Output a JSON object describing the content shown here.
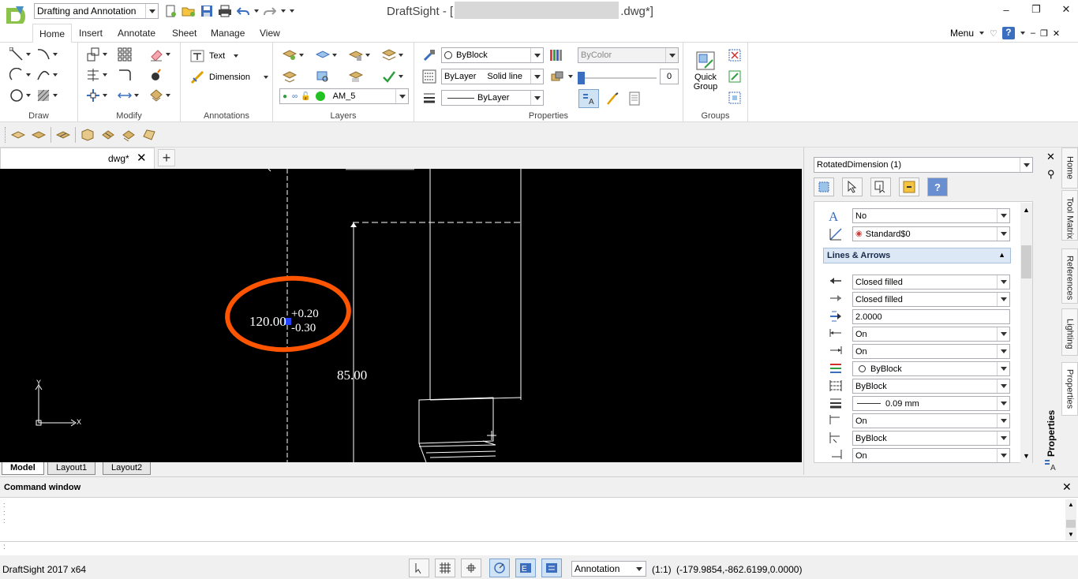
{
  "title_bar": {
    "workspace": "Drafting and Annotation",
    "app_title_prefix": "DraftSight - [",
    "app_title_suffix": ".dwg*]"
  },
  "ribbon_tabs": [
    "Home",
    "Insert",
    "Annotate",
    "Sheet",
    "Manage",
    "View"
  ],
  "ribbon_right": {
    "menu_label": "Menu"
  },
  "groups": {
    "draw": "Draw",
    "modify": "Modify",
    "annotations": "Annotations",
    "layers": "Layers",
    "properties": "Properties",
    "groups": "Groups"
  },
  "annotations": {
    "text_label": "Text",
    "dimension_label": "Dimension"
  },
  "layers": {
    "current_layer": "AM_5"
  },
  "properties": {
    "color": "ByBlock",
    "linestyle_layer": "ByLayer",
    "linestyle_style": "Solid line",
    "lineweight": "ByLayer",
    "transparency_color": "ByColor",
    "transparency_value": "0"
  },
  "groups_panel": {
    "quick_group_line1": "Quick",
    "quick_group_line2": "Group"
  },
  "document": {
    "tab_name": "dwg*"
  },
  "canvas": {
    "dimension_main": "120.00",
    "tolerance_upper": "+0.20",
    "tolerance_lower": "-0.30",
    "dimension_85": "85.00",
    "axis_x": "X",
    "axis_y": "Y"
  },
  "layout_tabs": [
    "Model",
    "Layout1",
    "Layout2"
  ],
  "props_panel": {
    "selection": "RotatedDimension (1)",
    "section_title": "Lines & Arrows",
    "rows_top": [
      {
        "icon": "text-style-icon",
        "value": "No"
      },
      {
        "icon": "dimension-style-icon",
        "value": "Standard$0"
      }
    ],
    "rows": [
      {
        "icon": "first-arrow-icon",
        "value": "Closed filled"
      },
      {
        "icon": "second-arrow-icon",
        "value": "Closed filled"
      },
      {
        "icon": "arrow-size-icon",
        "value": "2.0000"
      },
      {
        "icon": "dim-line1-icon",
        "value": "On"
      },
      {
        "icon": "dim-line2-icon",
        "value": "On"
      },
      {
        "icon": "dim-line-color-icon",
        "value": "ByBlock"
      },
      {
        "icon": "dim-line-style-icon",
        "value": "ByBlock"
      },
      {
        "icon": "dim-line-weight-icon",
        "value": "0.09 mm"
      },
      {
        "icon": "ext-line1-icon",
        "value": "On"
      },
      {
        "icon": "ext-line-style-icon",
        "value": "ByBlock"
      },
      {
        "icon": "ext-line2-icon",
        "value": "On"
      }
    ]
  },
  "side_tabs": [
    "Home",
    "Tool Matrix",
    "References",
    "Lighting",
    "Properties"
  ],
  "side_panel_title": "Properties",
  "command_window": {
    "title": "Command window"
  },
  "status": {
    "app_version": "DraftSight 2017 x64",
    "annotation_label": "Annotation",
    "scale": "(1:1)",
    "coordinates": "(-179.9854,-862.6199,0.0000)"
  },
  "colors": {
    "canvas": "#000000",
    "highlight": "#ff5500",
    "accent": "#3c6ebf"
  }
}
